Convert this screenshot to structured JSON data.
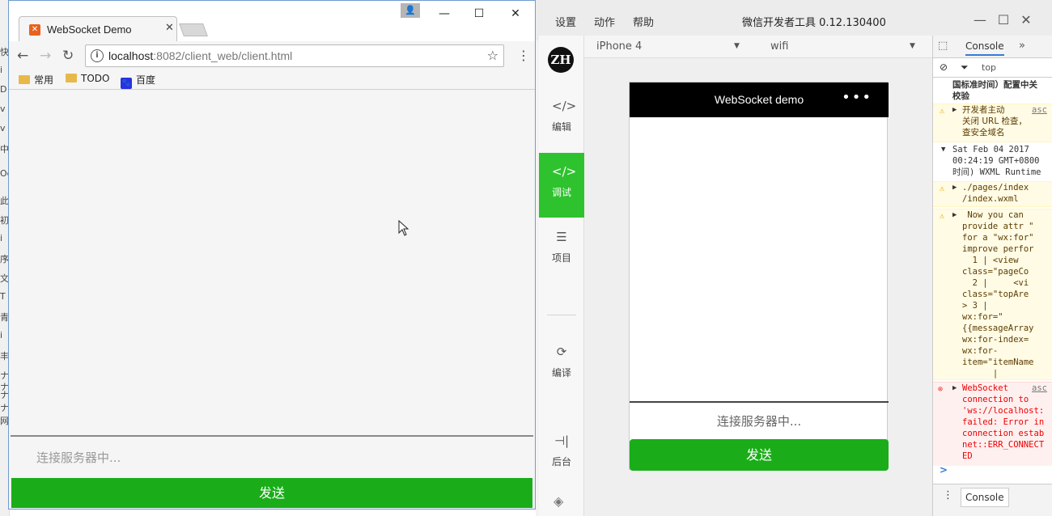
{
  "background": {
    "fragments": [
      "快",
      "i",
      "D",
      "v",
      "v",
      "中",
      "Oc",
      "此",
      "初",
      "i",
      "序",
      "文",
      "T",
      "青",
      "i",
      "丰",
      "ナ",
      "ナ",
      "ナ",
      "ナ",
      "网"
    ]
  },
  "devtools": {
    "menu": [
      "设置",
      "动作",
      "帮助"
    ],
    "title": "微信开发者工具 0.12.130400",
    "avatar_text": "ZH",
    "nav": [
      {
        "label": "编辑",
        "icon": "code-box-icon"
      },
      {
        "label": "调试",
        "icon": "debug-code-icon"
      },
      {
        "label": "项目",
        "icon": "menu-lines-icon"
      },
      {
        "label": "编译",
        "icon": "compile-icon"
      },
      {
        "label": "后台",
        "icon": "background-icon"
      }
    ],
    "device": "iPhone 4",
    "network": "wifi",
    "phone": {
      "nav_title": "WebSocket demo",
      "menu_dots": "•••",
      "input_text": "连接服务器中...",
      "send_label": "发送"
    },
    "console": {
      "tab": "Console",
      "filter_top": "top",
      "drawer_tab": "Console",
      "prompt": ">",
      "logs": [
        {
          "type": "plain",
          "text": "国标准时间）配置中关\n校验"
        },
        {
          "type": "warn",
          "text": "开发者主动\n关闭 URL 检查，\n查安全域名",
          "src": "asc"
        },
        {
          "type": "group",
          "text": "Sat Feb 04 2017\n00:24:19 GMT+0800\n时间) WXML Runtime"
        },
        {
          "type": "warn",
          "text": "./pages/index\n/index.wxml",
          "src": ""
        },
        {
          "type": "warn",
          "text": " Now you can\nprovide attr \"\nfor a \"wx:for\"\nimprove perfor\n  1 | <view\nclass=\"pageCo\n  2 |     <vi\nclass=\"topAre\n> 3 |\nwx:for=\"\n{{messageArray\nwx:for-index=\nwx:for-\nitem=\"itemName\n      |",
          "src": ""
        },
        {
          "type": "err",
          "text": "WebSocket\nconnection to\n'ws://localhost:\nfailed: Error in\nconnection estab\nnet::ERR_CONNECT\nED",
          "src": "asc"
        }
      ]
    }
  },
  "chrome": {
    "tab_title": "WebSocket Demo",
    "url_host": "localhost",
    "url_rest": ":8082/client_web/client.html",
    "bookmarks": [
      "常用",
      "TODO",
      "百度"
    ],
    "page": {
      "input_placeholder": "连接服务器中...",
      "send_label": "发送"
    }
  }
}
